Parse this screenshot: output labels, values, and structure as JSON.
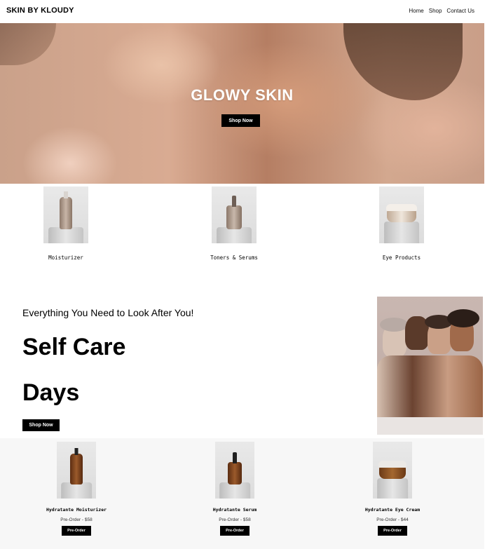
{
  "header": {
    "brand": "SKIN BY KLOUDY",
    "nav": [
      "Home",
      "Shop",
      "Contact Us"
    ]
  },
  "hero": {
    "title": "GLOWY SKIN",
    "button": "Shop Now"
  },
  "categories": [
    {
      "label": "Moisturizer"
    },
    {
      "label": "Toners & Serums"
    },
    {
      "label": "Eye Products"
    }
  ],
  "self_care": {
    "subtitle": "Everything You Need to Look After You!",
    "line1": "Self Care",
    "line2": "Days",
    "button": "Shop Now"
  },
  "products": [
    {
      "name": "Hydratante Moisturizer",
      "price": "Pre-Order - $58",
      "button": "Pre-Order"
    },
    {
      "name": "Hydratante Serum",
      "price": "Pre-Order - $58",
      "button": "Pre-Order"
    },
    {
      "name": "Hydratante Eye Cream",
      "price": "Pre-Order - $44",
      "button": "Pre-Order"
    }
  ]
}
